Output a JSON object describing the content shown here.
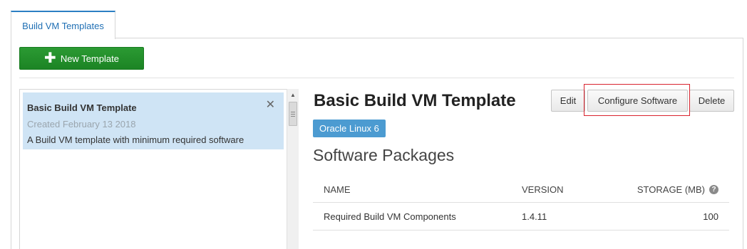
{
  "tabs": [
    {
      "label": "Build VM Templates"
    }
  ],
  "toolbar": {
    "new_template_label": "New Template"
  },
  "template_list": [
    {
      "title": "Basic Build VM Template",
      "created": "Created February 13 2018",
      "description": "A Build VM template with minimum required software",
      "close_glyph": "✕"
    }
  ],
  "detail": {
    "title": "Basic Build VM Template",
    "os_badge": "Oracle Linux 6",
    "buttons": {
      "edit": "Edit",
      "configure": "Configure Software",
      "delete": "Delete"
    },
    "section_title": "Software Packages",
    "table": {
      "headers": {
        "name": "NAME",
        "version": "VERSION",
        "storage": "STORAGE (MB)"
      },
      "rows": [
        {
          "name": "Required Build VM Components",
          "version": "1.4.11",
          "storage": "100"
        }
      ]
    }
  },
  "colors": {
    "accent_blue": "#2b7fc3",
    "new_button_green": "#1c8424",
    "selected_item_bg": "#cfe4f5",
    "os_badge_bg": "#4c9bd1",
    "highlight_red": "#d9232e"
  },
  "icons": {
    "plus": "plus-icon",
    "close": "close-icon",
    "help": "help-icon",
    "scroll_up": "scroll-up-icon"
  }
}
